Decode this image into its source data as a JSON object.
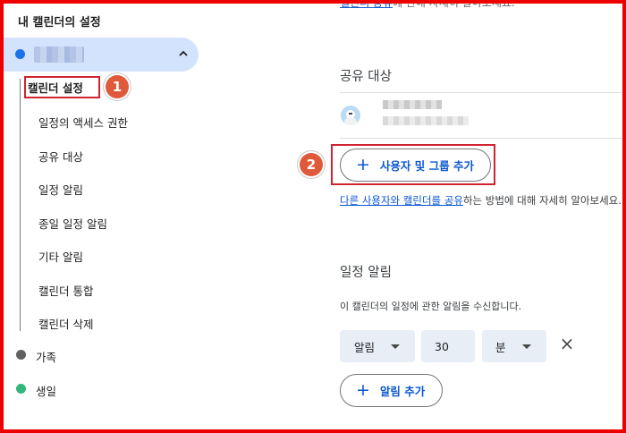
{
  "sidebar": {
    "title": "내 캘린더의 설정",
    "active_calendar": {
      "color": "#1a73e8",
      "name_blurred": true
    },
    "sub_items": [
      {
        "label": "캘린더 설정",
        "selected": true
      },
      {
        "label": "일정의 액세스 권한"
      },
      {
        "label": "공유 대상"
      },
      {
        "label": "일정 알림"
      },
      {
        "label": "종일 일정 알림"
      },
      {
        "label": "기타 알림"
      },
      {
        "label": "캘린더 통합"
      },
      {
        "label": "캘린더 삭제"
      }
    ],
    "other_calendars": [
      {
        "label": "가족",
        "color": "#616161"
      },
      {
        "label": "생일",
        "color": "#33b679"
      }
    ]
  },
  "annotations": {
    "step1": "1",
    "step2": "2",
    "highlight_color": "#d0242f",
    "badge_color": "#de5a3a"
  },
  "top_link": {
    "link": "캘린더 공유",
    "suffix": "에 관해 자세히 알아보세요."
  },
  "share": {
    "heading": "공유 대상",
    "add_button": "사용자 및 그룹 추가",
    "add_icon": "+",
    "help_link": "다른 사용자와 캘린더를 공유",
    "help_suffix": "하는 방법에 대해 자세히 알아보세요."
  },
  "notifications": {
    "heading": "일정 알림",
    "description": "이 캘린더의 일정에 관한 알림을 수신합니다.",
    "type_value": "알림",
    "amount_value": "30",
    "unit_value": "분",
    "remove_icon": "×",
    "add_button": "알림 추가",
    "add_icon": "+"
  },
  "colors": {
    "accent": "#0b57d0",
    "active_bg": "#d3e3fd",
    "select_bg": "#e8eef6",
    "frame": "#ee0000"
  }
}
